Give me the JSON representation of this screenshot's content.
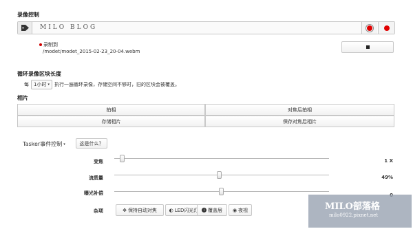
{
  "record": {
    "heading": "录像控制",
    "blog_title": "MILO BLOG",
    "status_text": "录制到",
    "path": "/modet/modet_2015-02-23_20-04.webm"
  },
  "loop": {
    "heading": "循环录像区块长度",
    "prefix": "每",
    "select_value": "1小时",
    "description": "执行一遍循环录像，存储空间不够时，旧的区块会被覆盖。"
  },
  "photo": {
    "heading": "相片",
    "buttons": [
      "拍相",
      "对焦后拍相",
      "存储相片",
      "保存对焦后相片"
    ]
  },
  "tasker": {
    "dropdown_label": "Tasker事件控制",
    "help_button": "这是什么？"
  },
  "sliders": [
    {
      "label": "变焦",
      "value_text": "1 X",
      "position": 0.04
    },
    {
      "label": "流质量",
      "value_text": "49%",
      "position": 0.49
    },
    {
      "label": "曝光补偿",
      "value_text": "0",
      "position": 0.5
    }
  ],
  "misc": {
    "label": "杂项",
    "buttons": [
      {
        "icon": "move-icon",
        "label": "保持自动对焦"
      },
      {
        "icon": "half-circle-icon",
        "label": "LED闪光灯"
      },
      {
        "icon": "info-icon",
        "label": "覆盖层"
      },
      {
        "icon": "eye-icon",
        "label": "夜视"
      }
    ]
  },
  "watermark": {
    "title": "MILO部落格",
    "url": "milo0922.pixnet.net"
  },
  "colors": {
    "record_red": "#e00000",
    "status_red": "#d00000"
  }
}
